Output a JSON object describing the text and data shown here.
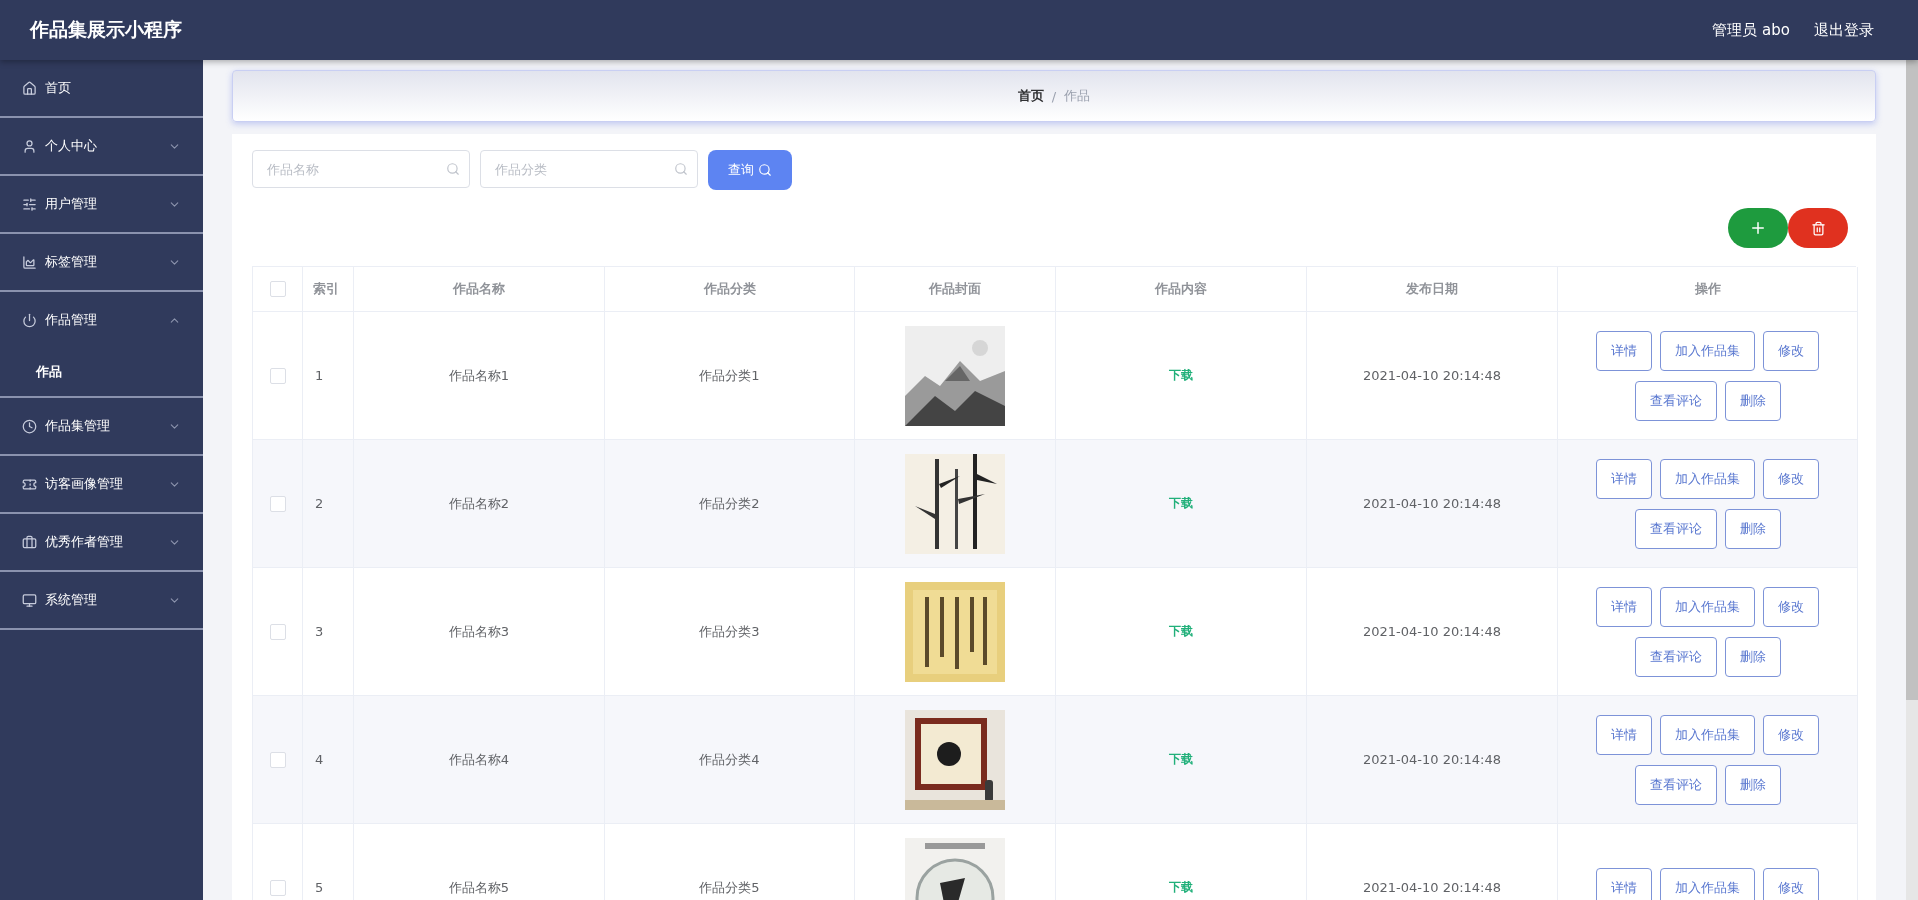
{
  "header": {
    "title": "作品集展示小程序",
    "user": "管理员 abo",
    "logout": "退出登录"
  },
  "sidebar": {
    "items": [
      {
        "kind": "link",
        "label": "首页"
      },
      {
        "kind": "group",
        "label": "个人中心",
        "expanded": false
      },
      {
        "kind": "group",
        "label": "用户管理",
        "expanded": false
      },
      {
        "kind": "group",
        "label": "标签管理",
        "expanded": false
      },
      {
        "kind": "group",
        "label": "作品管理",
        "expanded": true,
        "children": [
          {
            "label": "作品",
            "selected": true
          }
        ]
      },
      {
        "kind": "group",
        "label": "作品集管理",
        "expanded": false
      },
      {
        "kind": "group",
        "label": "访客画像管理",
        "expanded": false
      },
      {
        "kind": "group",
        "label": "优秀作者管理",
        "expanded": false
      },
      {
        "kind": "group",
        "label": "系统管理",
        "expanded": false
      }
    ]
  },
  "breadcrumb": {
    "items": [
      "首页",
      "作品"
    ],
    "separator": "/"
  },
  "search": {
    "fields": [
      {
        "placeholder": "作品名称"
      },
      {
        "placeholder": "作品分类"
      }
    ],
    "button": "查询"
  },
  "table": {
    "select_all": {
      "checked": false
    },
    "columns": [
      "索引",
      "作品名称",
      "作品分类",
      "作品封面",
      "作品内容",
      "发布日期",
      "操作"
    ],
    "rows": [
      {
        "checked": false,
        "index": "1",
        "name": "作品名称1",
        "category": "作品分类1",
        "content": "下载",
        "date": "2021-04-10 20:14:48",
        "actions": [
          "详情",
          "加入作品集",
          "修改",
          "查看评论",
          "删除"
        ]
      },
      {
        "checked": false,
        "index": "2",
        "name": "作品名称2",
        "category": "作品分类2",
        "content": "下载",
        "date": "2021-04-10 20:14:48",
        "actions": [
          "详情",
          "加入作品集",
          "修改",
          "查看评论",
          "删除"
        ]
      },
      {
        "checked": false,
        "index": "3",
        "name": "作品名称3",
        "category": "作品分类3",
        "content": "下载",
        "date": "2021-04-10 20:14:48",
        "actions": [
          "详情",
          "加入作品集",
          "修改",
          "查看评论",
          "删除"
        ]
      },
      {
        "checked": false,
        "index": "4",
        "name": "作品名称4",
        "category": "作品分类4",
        "content": "下载",
        "date": "2021-04-10 20:14:48",
        "actions": [
          "详情",
          "加入作品集",
          "修改",
          "查看评论",
          "删除"
        ]
      },
      {
        "checked": false,
        "index": "5",
        "name": "作品名称5",
        "category": "作品分类5",
        "content": "下载",
        "date": "2021-04-10 20:14:48",
        "actions": [
          "详情",
          "加入作品集",
          "修改"
        ]
      }
    ]
  }
}
